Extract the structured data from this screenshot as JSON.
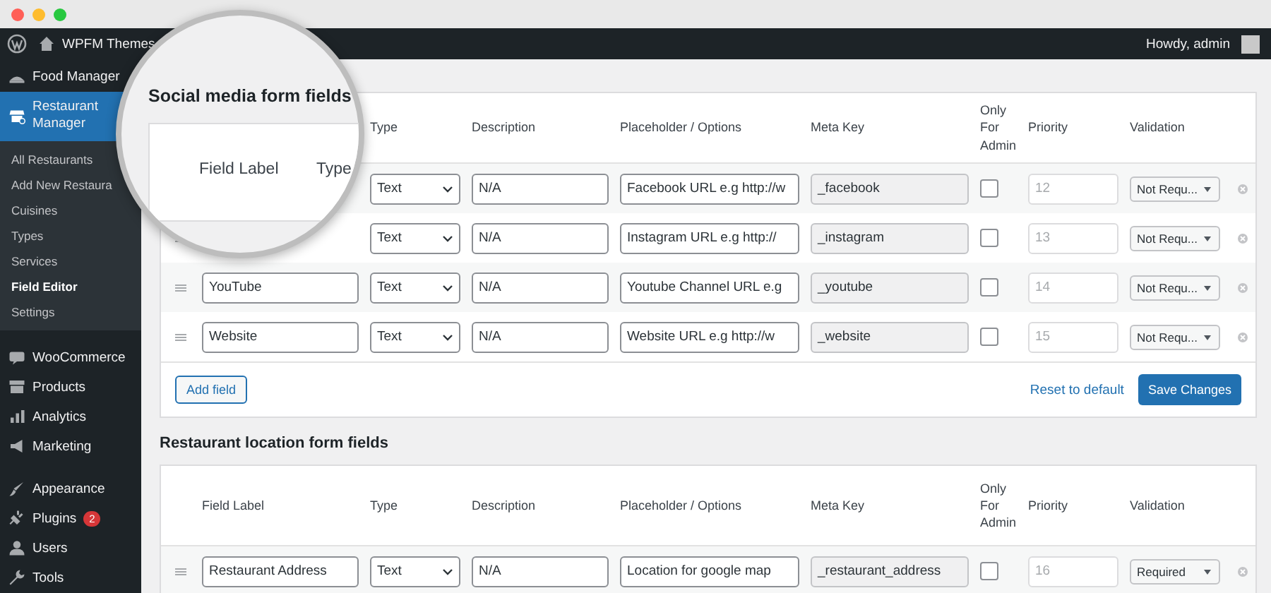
{
  "admin_bar": {
    "site_name": "WPFM Themes",
    "greeting": "Howdy, admin"
  },
  "sidebar": {
    "groups": [
      {
        "items": [
          {
            "label": "Food Manager",
            "selected": false
          },
          {
            "label": "Restaurant Manager",
            "selected": true,
            "children": [
              {
                "label": "All Restaurants",
                "selected": false
              },
              {
                "label": "Add New Restaura",
                "selected": false
              },
              {
                "label": "Cuisines",
                "selected": false
              },
              {
                "label": "Types",
                "selected": false
              },
              {
                "label": "Services",
                "selected": false
              },
              {
                "label": "Field Editor",
                "selected": true
              },
              {
                "label": "Settings",
                "selected": false
              }
            ]
          }
        ]
      },
      {
        "items": [
          {
            "label": "WooCommerce",
            "selected": false
          },
          {
            "label": "Products",
            "selected": false
          },
          {
            "label": "Analytics",
            "selected": false
          },
          {
            "label": "Marketing",
            "selected": false
          }
        ]
      },
      {
        "items": [
          {
            "label": "Appearance",
            "selected": false
          },
          {
            "label": "Plugins",
            "selected": false,
            "badge": "2"
          },
          {
            "label": "Users",
            "selected": false
          },
          {
            "label": "Tools",
            "selected": false
          }
        ]
      }
    ]
  },
  "magnifier": {
    "title": "Social media form fields",
    "columns": [
      "Field Label",
      "Type"
    ]
  },
  "sections": [
    {
      "columns": [
        "Type",
        "Description",
        "Placeholder / Options",
        "Meta Key",
        "Only For Admin",
        "Priority",
        "Validation"
      ],
      "rows": [
        {
          "type": "Text",
          "description": "N/A",
          "placeholder": "Facebook URL e.g http://w",
          "meta_key": "_facebook",
          "admin_only": false,
          "priority": "12",
          "validation": "Not Requ..."
        },
        {
          "type": "Text",
          "description": "N/A",
          "placeholder": "Instagram URL e.g http://",
          "meta_key": "_instagram",
          "admin_only": false,
          "priority": "13",
          "validation": "Not Requ..."
        },
        {
          "label": "YouTube",
          "type": "Text",
          "description": "N/A",
          "placeholder": "Youtube Channel URL e.g",
          "meta_key": "_youtube",
          "admin_only": false,
          "priority": "14",
          "validation": "Not Requ..."
        },
        {
          "label": "Website",
          "type": "Text",
          "description": "N/A",
          "placeholder": "Website URL e.g http://w",
          "meta_key": "_website",
          "admin_only": false,
          "priority": "15",
          "validation": "Not Requ..."
        }
      ],
      "footer": {
        "add_button": "Add field",
        "reset_link": "Reset to default",
        "save_button": "Save Changes"
      }
    },
    {
      "title": "Restaurant location form fields",
      "columns": [
        "Field Label",
        "Type",
        "Description",
        "Placeholder / Options",
        "Meta Key",
        "Only For Admin",
        "Priority",
        "Validation"
      ],
      "rows": [
        {
          "label": "Restaurant Address",
          "type": "Text",
          "description": "N/A",
          "placeholder": "Location for google map",
          "meta_key": "_restaurant_address",
          "admin_only": false,
          "priority": "16",
          "validation": "Required"
        }
      ]
    }
  ]
}
